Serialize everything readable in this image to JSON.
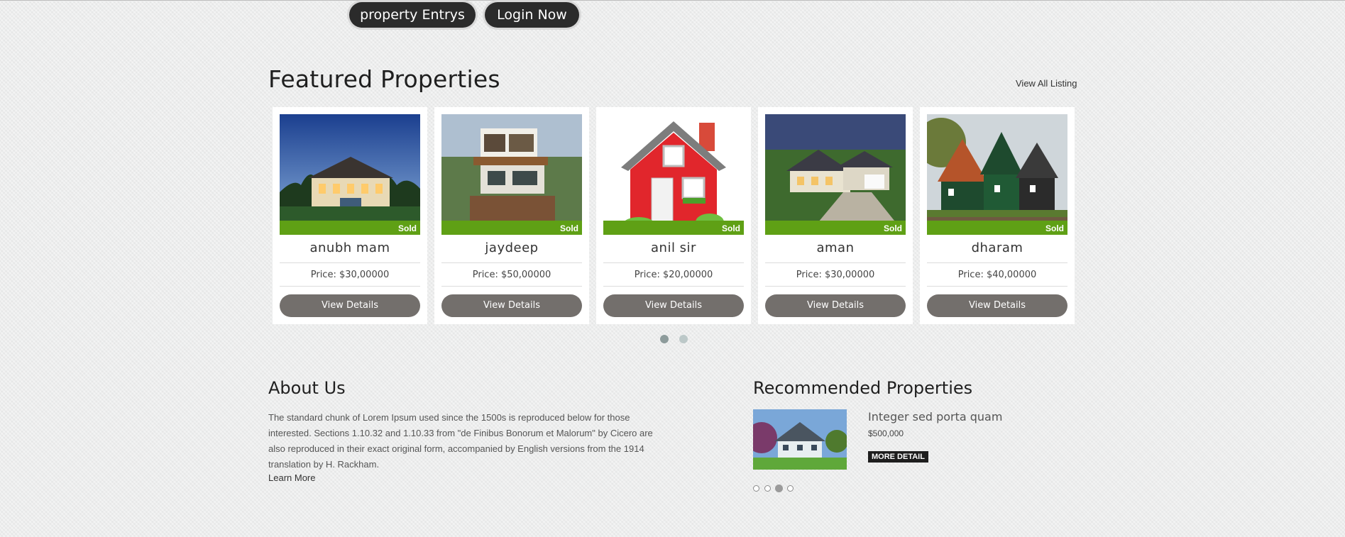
{
  "header": {
    "property_entries_label": "property Entrys",
    "login_label": "Login Now"
  },
  "featured": {
    "title": "Featured Properties",
    "view_all_label": "View All Listing",
    "cards": [
      {
        "name": "anubh mam",
        "price": "Price: $30,00000",
        "badge": "Sold",
        "button": "View Details",
        "image": "villa-night"
      },
      {
        "name": "jaydeep",
        "price": "Price: $50,00000",
        "badge": "Sold",
        "button": "View Details",
        "image": "modern-house"
      },
      {
        "name": "anil sir",
        "price": "Price: $20,00000",
        "badge": "Sold",
        "button": "View Details",
        "image": "red-house-illustration"
      },
      {
        "name": "aman",
        "price": "Price: $30,00000",
        "badge": "Sold",
        "button": "View Details",
        "image": "suburban-house"
      },
      {
        "name": "dharam",
        "price": "Price: $40,00000",
        "badge": "Sold",
        "button": "View Details",
        "image": "dutch-houses"
      }
    ],
    "pagination": {
      "pages": 2,
      "active": 1
    }
  },
  "about": {
    "title": "About Us",
    "text": "The standard chunk of Lorem Ipsum used since the 1500s is reproduced below for those interested. Sections 1.10.32 and 1.10.33 from \"de Finibus Bonorum et Malorum\" by Cicero are also reproduced in their exact original form, accompanied by English versions from the 1914 translation by H. Rackham.",
    "learn_more": "Learn More"
  },
  "recommended": {
    "title": "Recommended Properties",
    "item": {
      "title": "Integer sed porta quam",
      "price": "$500,000",
      "button": "MORE DETAIL"
    },
    "pagination": {
      "pages": 4,
      "active": 3
    }
  },
  "colors": {
    "sold_bar": "#5fa015",
    "button": "#736f6c",
    "pill": "#2b2b2b"
  }
}
